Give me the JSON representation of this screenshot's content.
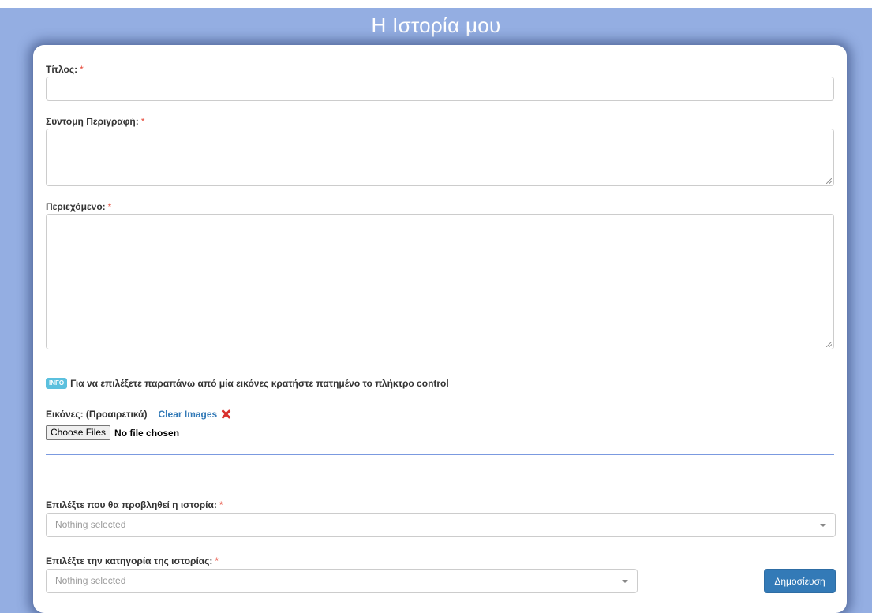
{
  "header": {
    "title": "Η Ιστορία μου"
  },
  "form": {
    "title_label": "Τίτλος:",
    "title_value": "",
    "summary_label": "Σύντομη Περιγραφή:",
    "summary_value": "",
    "content_label": "Περιεχόμενο:",
    "content_value": "",
    "required_mark": "*",
    "info_badge": "INFO",
    "info_text": "Για να επιλέξετε παραπάνω από μία εικόνες κρατήστε πατημένο το πλήκτρο control",
    "images_label": "Εικόνες: (Προαιρετικά)",
    "clear_images": "Clear Images",
    "choose_files": "Choose Files",
    "no_file": "No file chosen",
    "display_label": "Επιλέξτε που θα προβληθεί η ιστορία:",
    "display_value": "Nothing selected",
    "category_label": "Επιλέξτε την κατηγορία της ιστορίας:",
    "category_value": "Nothing selected",
    "publish_button": "Δημοσίευση"
  },
  "colors": {
    "background": "#94aee2",
    "required": "#e74c3c",
    "link": "#337ab7",
    "primary": "#337ab7",
    "info": "#5bc0de",
    "clear_icon": "#d9302c"
  },
  "icons": {
    "clear": "close-icon",
    "select_caret": "chevron-down-icon"
  }
}
